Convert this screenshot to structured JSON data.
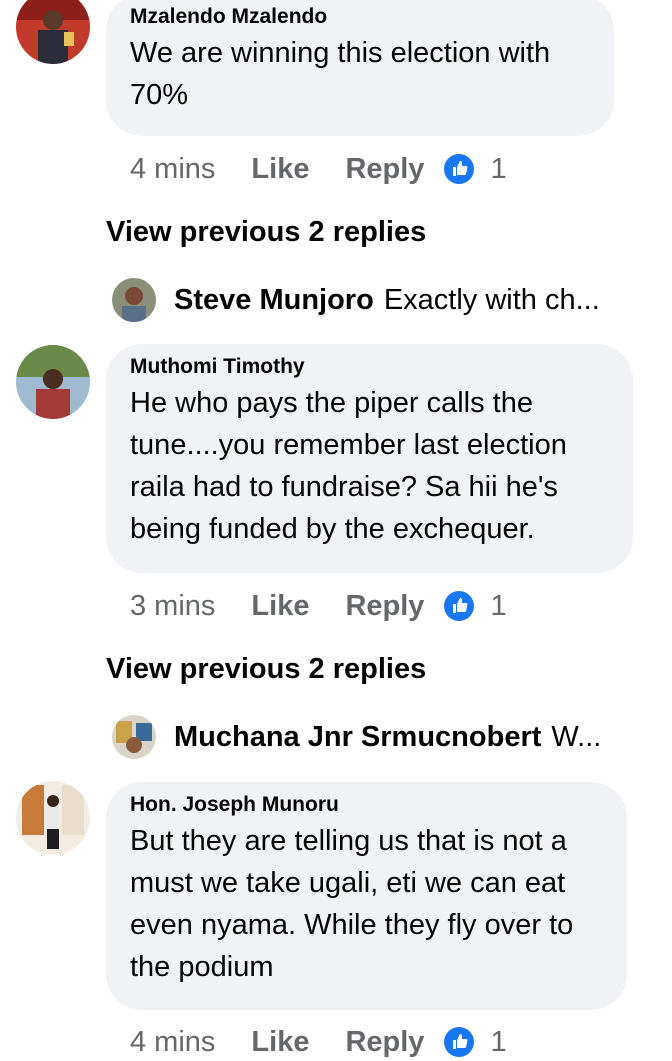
{
  "colors": {
    "bubble_bg": "#f0f2f5",
    "meta_text": "#65676b",
    "like_blue": "#1877f2"
  },
  "comments": [
    {
      "author": "Mzalendo Mzalendo",
      "text": "We are winning this election with 70%",
      "time": "4 mins",
      "like_label": "Like",
      "reply_label": "Reply",
      "reaction_icon": "like-reaction-icon",
      "reaction_count": "1",
      "view_previous": "View previous 2 replies",
      "latest_reply": {
        "author": "Steve Munjoro",
        "text": "Exactly with ch..."
      }
    },
    {
      "author": "Muthomi Timothy",
      "text": "He who pays the piper calls the tune....you remember last election raila had to fundraise? Sa hii he's being funded by the exchequer.",
      "time": "3 mins",
      "like_label": "Like",
      "reply_label": "Reply",
      "reaction_icon": "like-reaction-icon",
      "reaction_count": "1",
      "view_previous": "View previous 2 replies",
      "latest_reply": {
        "author": "Muchana Jnr Srmucnobert",
        "text": "W..."
      }
    },
    {
      "author": "Hon. Joseph Munoru",
      "text": "But they are telling us that is not a must we take ugali, eti we can eat even nyama. While they fly over to the podium",
      "time": "4 mins",
      "like_label": "Like",
      "reply_label": "Reply",
      "reaction_icon": "like-reaction-icon",
      "reaction_count": "1"
    }
  ]
}
